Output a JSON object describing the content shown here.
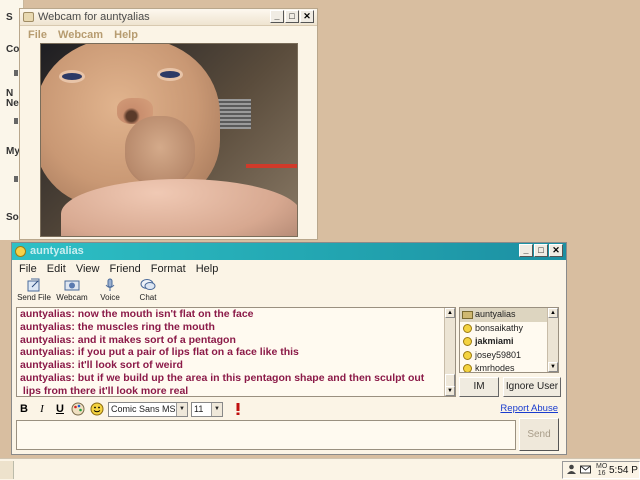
{
  "desktop": {
    "bg_labels": [
      "S",
      "Co",
      "N",
      "Nei",
      "My",
      "So"
    ]
  },
  "webcam_window": {
    "title": "Webcam for auntyalias",
    "menu": [
      "File",
      "Webcam",
      "Help"
    ],
    "controls": {
      "minimize": "_",
      "maximize": "□",
      "close": "✕"
    }
  },
  "im_window": {
    "title": "auntyalias",
    "menu": [
      "File",
      "Edit",
      "View",
      "Friend",
      "Format",
      "Help"
    ],
    "toolbar": [
      {
        "label": "Send File",
        "icon": "send-file-icon"
      },
      {
        "label": "Webcam",
        "icon": "webcam-icon"
      },
      {
        "label": "Voice",
        "icon": "microphone-icon"
      },
      {
        "label": "Chat",
        "icon": "chat-bubble-icon"
      }
    ],
    "messages": [
      "auntyalias: now the mouth isn't flat on the face",
      "auntyalias: the muscles ring the mouth",
      "auntyalias: and it makes sort of a pentagon",
      "auntyalias: if you put a pair of lips flat on a face like this",
      "auntyalias: it'll look sort of weird",
      "auntyalias: but if we build up the area in this pentagon shape and then sculpt out",
      " lips from there it'll look more real"
    ],
    "users": [
      {
        "name": "auntyalias",
        "icon": "webcam-icon",
        "selected": true,
        "bold": false
      },
      {
        "name": "bonsaikathy",
        "icon": "smiley-icon",
        "selected": false,
        "bold": false
      },
      {
        "name": "jakmiami",
        "icon": "smiley-icon",
        "selected": false,
        "bold": true
      },
      {
        "name": "josey59801",
        "icon": "smiley-icon",
        "selected": false,
        "bold": false
      },
      {
        "name": "kmrhodes",
        "icon": "smiley-icon",
        "selected": false,
        "bold": false
      }
    ],
    "im_button": "IM",
    "ignore_button": "Ignore User",
    "format": {
      "bold": "B",
      "italic": "I",
      "underline": "U",
      "font": "Comic Sans MS",
      "size": "11"
    },
    "report_abuse": "Report Abuse",
    "input_value": "",
    "send_button": "Send"
  },
  "taskbar": {
    "day": "MO\n16",
    "time": "5:54 P"
  }
}
